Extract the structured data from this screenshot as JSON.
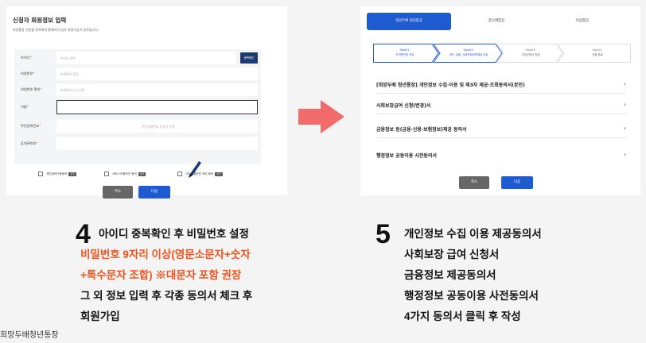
{
  "left": {
    "title": "신청자 회원정보 입력",
    "subtitle": "희망통장 신청을 완료해야 홈페이지 일반 회원가입이 완료됩니다.",
    "fields": [
      {
        "label": "아이디",
        "placeholder": "아이디 입력"
      },
      {
        "label": "비밀번호",
        "placeholder": "비밀번호 입력"
      },
      {
        "label": "비밀번호 확인",
        "placeholder": "비밀번호 다시 입력"
      },
      {
        "label": "이름",
        "placeholder": ""
      },
      {
        "label": "주민등록번호",
        "placeholder": "- 주민등록번호 뒷자리 입력"
      },
      {
        "label": "휴대폰번호",
        "placeholder": ""
      }
    ],
    "required_mark": "*",
    "dup_check_label": "중복확인",
    "agreements": [
      {
        "label": "개인정보이용동의",
        "tag": "보기"
      },
      {
        "label": "서비스이용약관 동의",
        "tag": "보기"
      },
      {
        "label": "고유식별번호 처리 동의",
        "tag": "보기"
      }
    ],
    "cancel_label": "취소",
    "next_label": "다음"
  },
  "right": {
    "tabs": [
      "희망두배 청년통장",
      "꿈나래통장",
      "이음통장"
    ],
    "steps": [
      {
        "num": "Step01.",
        "label": "자격판단표 작성"
      },
      {
        "num": "Step02.",
        "label": "개인, 금융, 사회보장정보제공 작성"
      },
      {
        "num": "Step03.",
        "label": "가입신청서 작성"
      },
      {
        "num": "Step04.",
        "label": "신청 완료"
      }
    ],
    "consents": [
      "[희망두배 청년통장] 개인정보 수집·이용 및 제3자 제공·조회동의서(본인)",
      "사회보장급여 신청(변경)서",
      "금융정보 등(금융·신용·보험정보)제공 동의서",
      "행정정보 공동이용 사전동의서"
    ],
    "chevron": "›",
    "cancel_label": "취소",
    "next_label": "다음"
  },
  "captions": {
    "left_num": "4",
    "left_lines": [
      "아이디 중복확인 후 비밀번호 설정",
      "비밀번호 9자리 이상(영문소문자+숫자",
      "+특수문자 조합) ※대문자 포함 권장",
      "그 외 정보 입력 후 각종 동의서 체크 후",
      "회원가입"
    ],
    "right_num": "5",
    "right_lines": [
      "개인정보 수집 이용 제공동의서",
      "사회보장 급여 신청서",
      "금융정보 제공동의서",
      "행정정보 공동이용 사전동의서",
      "4가지 동의서 클릭 후 작성"
    ],
    "brand": "희망두배청년통장"
  },
  "colors": {
    "accent": "#1f5bd0",
    "highlight": "#f0541e",
    "arrow": "#f26b6b",
    "navy": "#1f3a6f"
  }
}
